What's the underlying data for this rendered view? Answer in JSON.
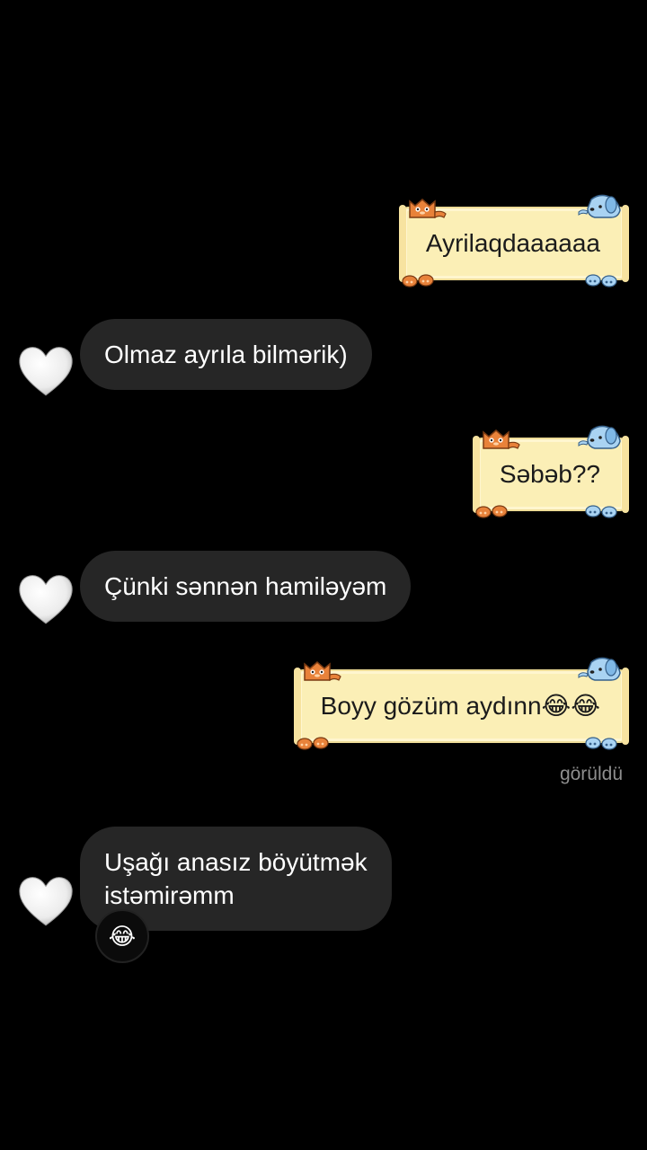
{
  "chat": {
    "messages": [
      {
        "direction": "outgoing",
        "text": "Ayrilaqdaaaaaa"
      },
      {
        "direction": "incoming",
        "text": "Olmaz ayrıla bilmərik)"
      },
      {
        "direction": "outgoing",
        "text": "Səbəb??"
      },
      {
        "direction": "incoming",
        "text": "Çünki sənnən hamiləyəm"
      },
      {
        "direction": "outgoing",
        "text": "Boyy gözüm aydınn😂😂"
      },
      {
        "direction": "incoming",
        "text_line1": "Uşağı anasız böyütmək",
        "text_line2": "istəmirəmm",
        "reaction": "😂"
      }
    ],
    "seen_label": "görüldü"
  },
  "icons": {
    "avatar": "white-heart-icon",
    "bubble_theme": "cat-and-dog-scroll"
  },
  "colors": {
    "background": "#000000",
    "incoming_bubble": "#262626",
    "outgoing_bubble": "#fbefb6",
    "seen_text": "#8e8e8e"
  }
}
